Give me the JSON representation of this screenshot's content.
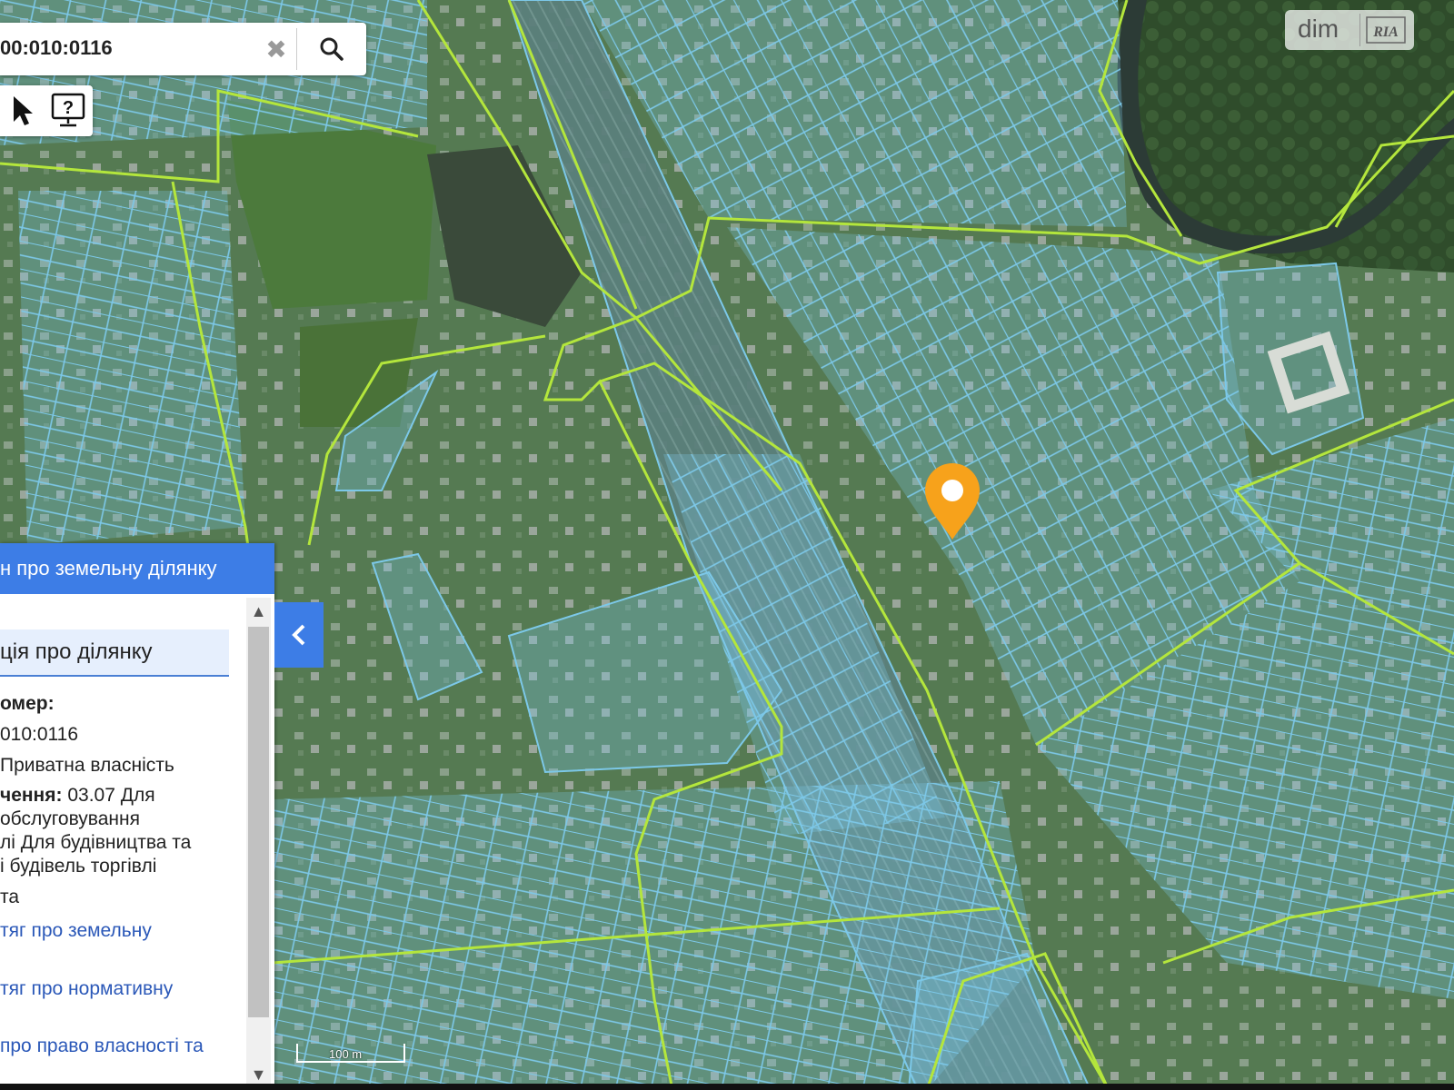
{
  "search": {
    "value": "00:010:0116",
    "clear_glyph": "✖"
  },
  "tools": {
    "pointer_icon": "arrow-pointer-icon",
    "info_icon": "help-monitor-icon"
  },
  "watermark": {
    "text": "dim",
    "badge": "RIA"
  },
  "panel": {
    "header": "н про земельну ділянку",
    "section_title": "ція про ділянку",
    "number_label": "омер:",
    "number_value": "010:0116",
    "ownership": "Приватна власність",
    "purpose_label": "чення:",
    "purpose_lines": [
      "03.07 Для",
      "обслуговування",
      "лі Для будівництва та",
      "і будівель торгівлі",
      "та"
    ],
    "links": [
      "тяг про земельну",
      "тяг про нормативну",
      "про право власності та"
    ]
  },
  "scale": {
    "label": "100 m"
  },
  "colors": {
    "parcel": "#7cc8e8",
    "boundary": "#b4e63c",
    "marker": "#f7a21b",
    "accent": "#3d7de6"
  }
}
